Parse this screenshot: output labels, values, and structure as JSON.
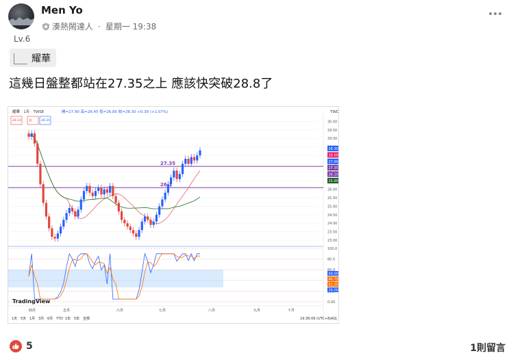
{
  "post": {
    "author": "Men Yo",
    "badge": "湊熱鬧達人",
    "separator": "·",
    "time": "星期一 19:38",
    "level": "Lv.6",
    "tag": "耀華",
    "text": "這幾日盤整都站在27.35之上 應該快突破28.8了",
    "like_count": "5",
    "comment_count": "1則留言"
  },
  "chart_data": {
    "type": "candlestick",
    "title": "耀華 · 1天 · TWSE",
    "ohlc_header": "開=27.90  高=28.45  低=26.85  收=28.30  +0.30 (+1.07%)",
    "price_axis_label": "TWD",
    "price_ticks": [
      "30.00",
      "29.50",
      "29.00",
      "28.50",
      "28.00",
      "27.50",
      "27.00",
      "26.50",
      "26.00",
      "25.50",
      "25.00",
      "24.50",
      "24.00",
      "23.50",
      "23.00"
    ],
    "ylim": [
      22.8,
      30.3
    ],
    "horizontal_lines": [
      {
        "label": "27.35",
        "value": 27.35,
        "color": "#7b3fa6"
      },
      {
        "label": "26.1",
        "value": 26.1,
        "color": "#7b3fa6"
      }
    ],
    "right_markers": [
      {
        "text": "28.30",
        "color": "#2962ff"
      },
      {
        "text": "28.09",
        "color": "#e91e63"
      },
      {
        "text": "27.90",
        "color": "#2962ff"
      },
      {
        "text": "27.35",
        "color": "#7b3fa6"
      },
      {
        "text": "26.10",
        "color": "#7b3fa6"
      },
      {
        "text": "25.90",
        "color": "#1b5e20"
      }
    ],
    "top_labels": [
      "28.10",
      "分",
      "28.35"
    ],
    "closes": [
      29.1,
      29.3,
      28.7,
      27.5,
      26.3,
      25.2,
      24.4,
      23.7,
      23.2,
      23.1,
      23.4,
      23.8,
      24.2,
      24.6,
      24.9,
      24.7,
      24.4,
      24.8,
      25.4,
      25.9,
      26.2,
      25.8,
      25.6,
      25.9,
      26.1,
      25.7,
      26.0,
      25.8,
      26.2,
      25.6,
      25.2,
      24.7,
      24.2,
      24.0,
      23.8,
      23.6,
      23.4,
      23.2,
      23.6,
      24.1,
      24.4,
      24.2,
      23.9,
      24.1,
      24.5,
      25.0,
      25.4,
      25.8,
      26.3,
      26.7,
      27.1,
      26.6,
      26.9,
      27.5,
      27.8,
      27.5,
      27.9,
      27.7,
      28.0,
      28.3
    ],
    "oscillator_ticks": [
      "100.0",
      "80.0",
      "60.0",
      "40.0",
      "20.0",
      "0.00"
    ],
    "oscillator_markers": [
      {
        "text": "49.00",
        "color": "#2962ff"
      },
      {
        "text": "46.79",
        "color": "#ff6d00"
      },
      {
        "text": "41.20",
        "color": "#ff6d00"
      },
      {
        "text": "26.00",
        "color": "#2962ff"
      }
    ],
    "x_months": [
      "四月",
      "五月",
      "六月",
      "七月",
      "八月",
      "九月",
      "十月"
    ],
    "timeframes": [
      "1天",
      "5天",
      "1月",
      "3月",
      "6月",
      "YTD",
      "1年",
      "5年",
      "全部"
    ],
    "clock": "19:36:09 (UTC+8)",
    "adj": "ADJ",
    "watermark": "TradingView"
  },
  "colors": {
    "up": "#2962ff",
    "down": "#e0483c",
    "ma_fast": "#e57373",
    "ma_slow": "#2e7d32",
    "level_line": "#7b3fa6",
    "like": "#e0483c"
  }
}
